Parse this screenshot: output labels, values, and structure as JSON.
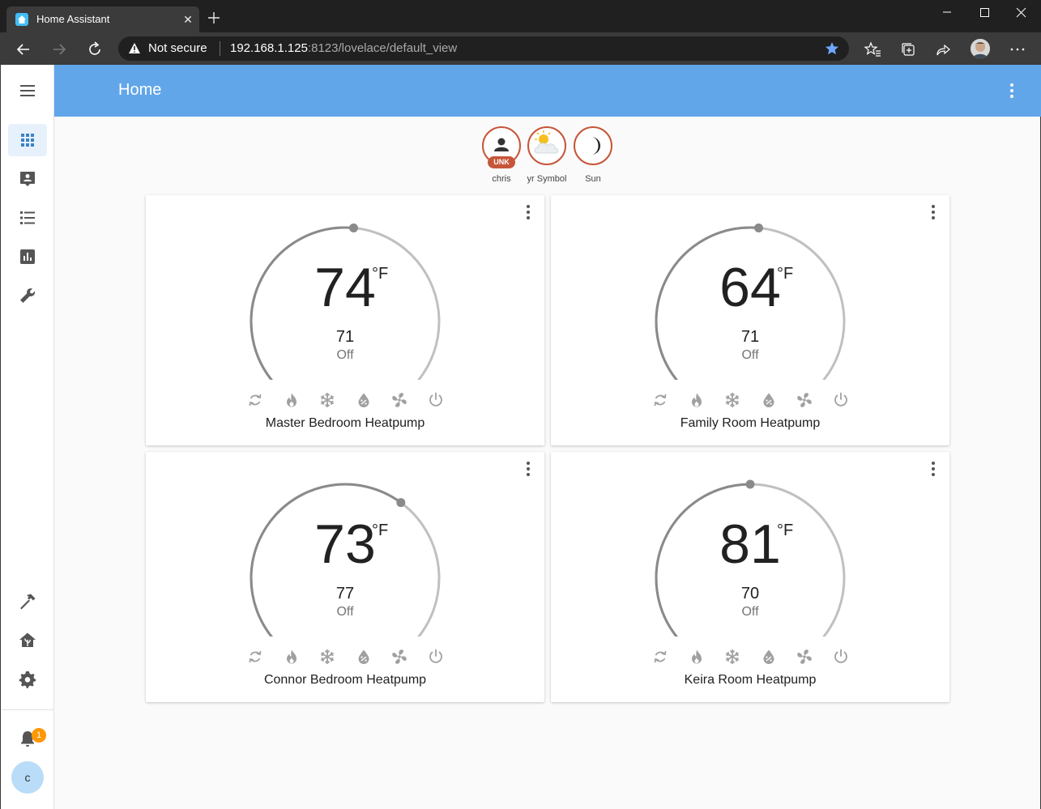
{
  "browser": {
    "tab_title": "Home Assistant",
    "security_label": "Not secure",
    "url_host": "192.168.1.125",
    "url_rest": ":8123/lovelace/default_view"
  },
  "header": {
    "title": "Home"
  },
  "sidebar": {
    "items": [
      {
        "icon": "overview-grid-icon"
      },
      {
        "icon": "map-icon"
      },
      {
        "icon": "logbook-icon"
      },
      {
        "icon": "history-icon"
      },
      {
        "icon": "configuration-wrench-icon"
      }
    ],
    "bottom_items": [
      {
        "icon": "developer-tools-hammer-icon"
      },
      {
        "icon": "supervisor-icon"
      },
      {
        "icon": "settings-gear-icon"
      }
    ],
    "notification_count": "1",
    "user_initial": "c"
  },
  "badges": [
    {
      "label": "chris",
      "pill": "UNK",
      "icon": "person-icon"
    },
    {
      "label": "yr Symbol",
      "icon": "partly-cloudy-icon"
    },
    {
      "label": "Sun",
      "icon": "moon-icon"
    }
  ],
  "thermostats": [
    {
      "name": "Master Bedroom Heatpump",
      "current": "74",
      "unit": "°F",
      "target": "71",
      "state": "Off"
    },
    {
      "name": "Family Room Heatpump",
      "current": "64",
      "unit": "°F",
      "target": "71",
      "state": "Off"
    },
    {
      "name": "Connor Bedroom Heatpump",
      "current": "73",
      "unit": "°F",
      "target": "77",
      "state": "Off"
    },
    {
      "name": "Keira Room Heatpump",
      "current": "81",
      "unit": "°F",
      "target": "70",
      "state": "Off"
    }
  ],
  "hvac_modes": [
    "auto-icon",
    "heat-icon",
    "cool-icon",
    "dry-icon",
    "fan-icon",
    "power-icon"
  ],
  "colors": {
    "header": "#62a6ea",
    "badge_border": "#c6563a",
    "notification": "#ff9800",
    "dial_active": "#8a8a8a",
    "dial_inactive": "#c0c0c0"
  }
}
